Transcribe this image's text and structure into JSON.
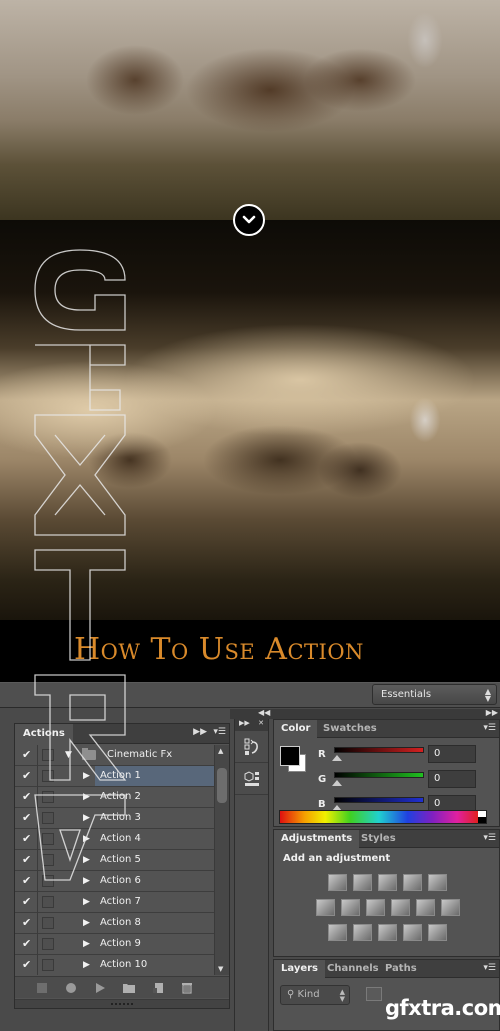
{
  "hero": {
    "scroll_button_icon": "chevron-down-icon",
    "title": "How To Use Action"
  },
  "watermark": {
    "vertical_text": "GFXTRA",
    "site": "gfxtra.com"
  },
  "photoshop": {
    "workspace": {
      "selected": "Essentials"
    },
    "actions_panel": {
      "tab": "Actions",
      "set": {
        "name": "Cinematic Fx",
        "checked": true,
        "expanded": true
      },
      "actions": [
        {
          "label": "Action 1",
          "checked": true,
          "selected": true
        },
        {
          "label": "Action 2",
          "checked": true,
          "selected": false
        },
        {
          "label": "Action 3",
          "checked": true,
          "selected": false
        },
        {
          "label": "Action 4",
          "checked": true,
          "selected": false
        },
        {
          "label": "Action 5",
          "checked": true,
          "selected": false
        },
        {
          "label": "Action 6",
          "checked": true,
          "selected": false
        },
        {
          "label": "Action 7",
          "checked": true,
          "selected": false
        },
        {
          "label": "Action 8",
          "checked": true,
          "selected": false
        },
        {
          "label": "Action 9",
          "checked": true,
          "selected": false
        },
        {
          "label": "Action 10",
          "checked": true,
          "selected": false
        }
      ],
      "footer_buttons": [
        "stop-icon",
        "record-icon",
        "play-icon",
        "folder-icon",
        "new-action-icon",
        "trash-icon"
      ]
    },
    "dock_icons": [
      "history-icon",
      "3d-properties-icon"
    ],
    "color_panel": {
      "tabs": [
        "Color",
        "Swatches"
      ],
      "active_tab": "Color",
      "channels": [
        {
          "label": "R",
          "value": "0",
          "color": "#d42020"
        },
        {
          "label": "G",
          "value": "0",
          "color": "#20c020"
        },
        {
          "label": "B",
          "value": "0",
          "color": "#2030d0"
        }
      ],
      "foreground": "#000000",
      "background": "#ffffff"
    },
    "adjustments_panel": {
      "tabs": [
        "Adjustments",
        "Styles"
      ],
      "active_tab": "Adjustments",
      "heading": "Add an adjustment",
      "rows": [
        [
          "brightness-contrast-icon",
          "levels-icon",
          "curves-icon",
          "exposure-icon",
          "vibrance-icon"
        ],
        [
          "hue-saturation-icon",
          "color-balance-icon",
          "black-white-icon",
          "photo-filter-icon",
          "channel-mixer-icon",
          "color-lookup-icon"
        ],
        [
          "invert-icon",
          "posterize-icon",
          "threshold-icon",
          "selective-color-icon",
          "gradient-map-icon"
        ]
      ]
    },
    "layers_panel": {
      "tabs": [
        "Layers",
        "Channels",
        "Paths"
      ],
      "active_tab": "Layers",
      "filter": "Kind"
    }
  }
}
